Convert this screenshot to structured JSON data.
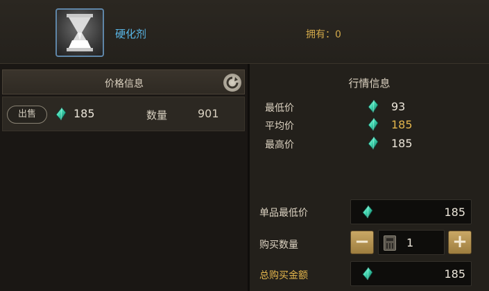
{
  "header": {
    "item_name": "硬化剂",
    "owned_text": "拥有：0",
    "item_icon": "hourglass-icon"
  },
  "price_panel": {
    "title": "价格信息",
    "refresh_icon": "refresh-icon",
    "listings": [
      {
        "action_label": "出售",
        "price": "185",
        "qty_label": "数量",
        "qty": "901"
      }
    ]
  },
  "market_panel": {
    "title": "行情信息",
    "stats": [
      {
        "label": "最低价",
        "value": "93"
      },
      {
        "label": "平均价",
        "value": "185"
      },
      {
        "label": "最高价",
        "value": "185"
      }
    ],
    "unit_min_label": "单品最低价",
    "unit_min_value": "185",
    "buy_qty_label": "购买数量",
    "buy_qty_value": "1",
    "minus_label": "−",
    "plus_label": "+",
    "total_label": "总购买金额",
    "total_value": "185"
  },
  "colors": {
    "accent_gold": "#e3b54c",
    "item_name_blue": "#59b6e6",
    "gem_green": "#3fd6b0"
  },
  "currency_icon": "green-gem-icon"
}
